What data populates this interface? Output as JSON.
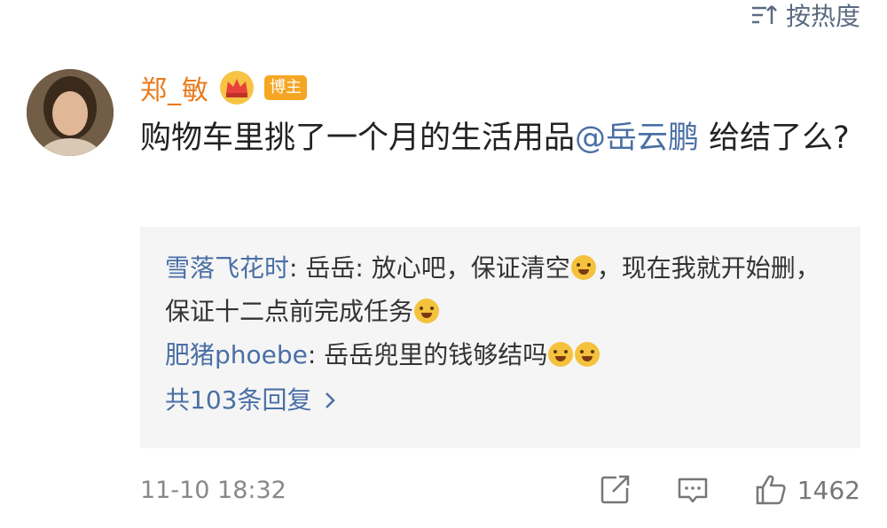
{
  "sort": {
    "label": "按热度"
  },
  "comment": {
    "username": "郑_敏",
    "badge": "博主",
    "text_before": "购物车里挑了一个月的生活用品",
    "mention": "@岳云鹏",
    "text_after": " 给结了么?"
  },
  "replies": [
    {
      "user": "雪落飞花时",
      "sep": ": ",
      "text_a": "岳岳: 放心吧，保证清空",
      "text_b": "，现在我就开始删，保证十二点前完成任务"
    },
    {
      "user": "肥猪phoebe",
      "sep": ": ",
      "text_a": "岳岳兜里的钱够结吗"
    }
  ],
  "more_replies": "共103条回复",
  "footer": {
    "timestamp": "11-10 18:32",
    "like_count": "1462"
  },
  "colors": {
    "username": "#e87b1c",
    "link": "#4a6fa5",
    "badge": "#f5a623",
    "reply_bg": "#f5f5f5"
  }
}
